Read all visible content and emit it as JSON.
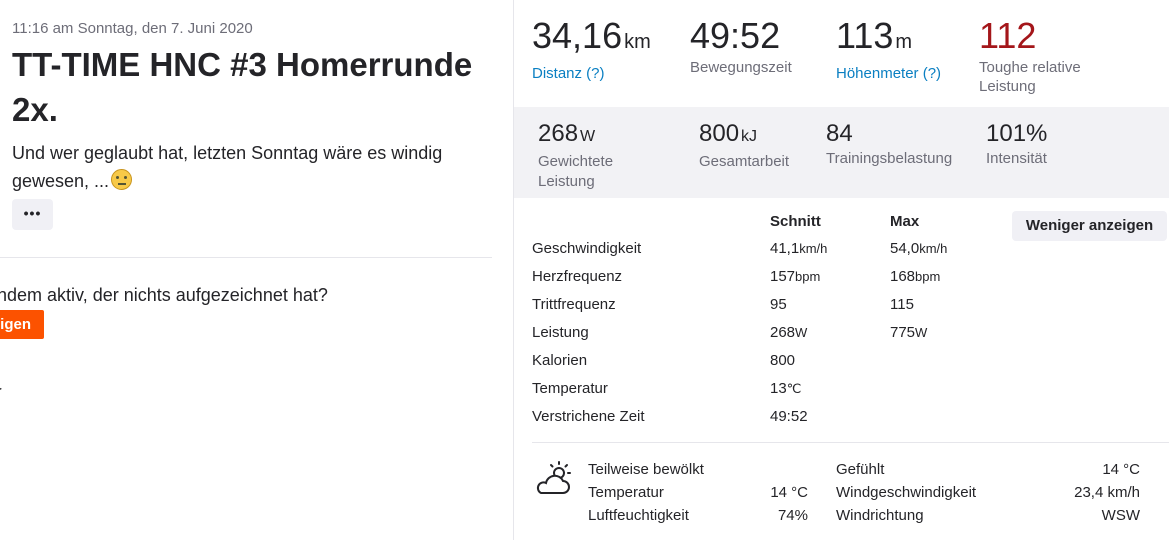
{
  "activity": {
    "datetime": "11:16 am Sonntag, den 7. Juni 2020",
    "title": "TT-TIME HNC #3 Homerrunde 2x.",
    "description": "Und wer geglaubt hat, letzten Sonntag wäre es windig gewesen, ...",
    "more_label": "•••",
    "question": "andem aktiv, der nichts aufgezeichnet hat?",
    "button_label": "igen",
    "caret": "▸"
  },
  "primary_stats": [
    {
      "value": "34,16",
      "unit": "km",
      "label": "Distanz (?)"
    },
    {
      "value": "49:52",
      "unit": "",
      "label": "Bewegungszeit"
    },
    {
      "value": "113",
      "unit": "m",
      "label": "Höhenmeter (?)"
    },
    {
      "value": "112",
      "unit": "",
      "label": "Toughe relative Leistung"
    }
  ],
  "secondary_stats": [
    {
      "value": "268",
      "unit": "W",
      "label": "Gewichtete Leistung"
    },
    {
      "value": "800",
      "unit": "kJ",
      "label": "Gesamtarbeit"
    },
    {
      "value": "84",
      "unit": "",
      "label": "Trainingsbelastung"
    },
    {
      "value": "101%",
      "unit": "",
      "label": "Intensität"
    }
  ],
  "details": {
    "col_avg": "Schnitt",
    "col_max": "Max",
    "less_button": "Weniger anzeigen",
    "rows": [
      {
        "name": "Geschwindigkeit",
        "avg": "41,1",
        "avg_unit": "km/h",
        "max": "54,0",
        "max_unit": "km/h"
      },
      {
        "name": "Herzfrequenz",
        "avg": "157",
        "avg_unit": "bpm",
        "max": "168",
        "max_unit": "bpm"
      },
      {
        "name": "Trittfrequenz",
        "avg": "95",
        "avg_unit": "",
        "max": "115",
        "max_unit": ""
      },
      {
        "name": "Leistung",
        "avg": "268",
        "avg_unit": "W",
        "max": "775",
        "max_unit": "W"
      },
      {
        "name": "Kalorien",
        "avg": "800",
        "avg_unit": "",
        "max": "",
        "max_unit": ""
      },
      {
        "name": "Temperatur",
        "avg": "13",
        "avg_unit": "℃",
        "max": "",
        "max_unit": ""
      },
      {
        "name": "Verstrichene Zeit",
        "avg": "49:52",
        "avg_unit": "",
        "max": "",
        "max_unit": ""
      }
    ]
  },
  "weather": {
    "icon": "partly-cloudy-icon",
    "condition": "Teilweise bewölkt",
    "temp_label": "Temperatur",
    "temp_value": "14 °C",
    "humidity_label": "Luftfeuchtigkeit",
    "humidity_value": "74%",
    "feels_label": "Gefühlt",
    "feels_value": "14 °C",
    "wind_speed_label": "Windgeschwindigkeit",
    "wind_speed_value": "23,4 km/h",
    "wind_dir_label": "Windrichtung",
    "wind_dir_value": "WSW"
  },
  "colors": {
    "brand_orange": "#fc5200",
    "link_blue": "#0a7fc2",
    "relative_effort_red": "#a4161a"
  }
}
